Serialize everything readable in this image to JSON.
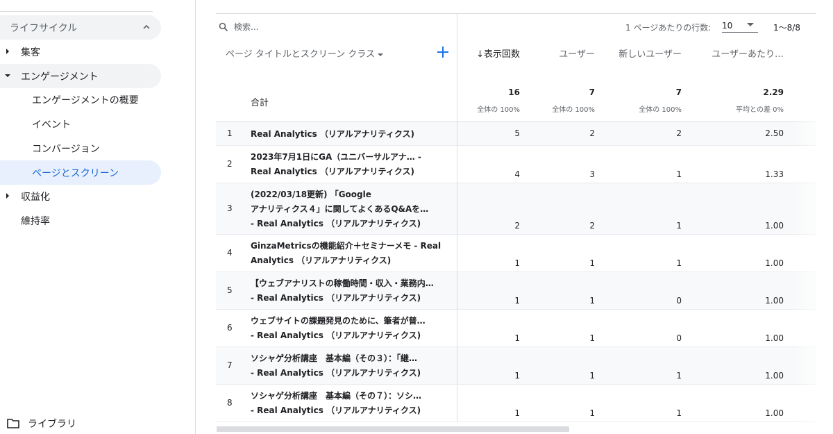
{
  "sidebar": {
    "section_title": "ライフサイクル",
    "items": [
      {
        "label": "集客"
      },
      {
        "label": "エンゲージメント"
      },
      {
        "label": "エンゲージメントの概要"
      },
      {
        "label": "イベント"
      },
      {
        "label": "コンバージョン"
      },
      {
        "label": "ページとスクリーン"
      },
      {
        "label": "収益化"
      },
      {
        "label": "維持率"
      }
    ],
    "library_label": "ライブラリ"
  },
  "toolbar": {
    "search_placeholder": "検索...",
    "rows_per_page_label": "1 ページあたりの行数:",
    "rows_per_page_value": "10",
    "pager_text": "1〜8/8"
  },
  "table": {
    "dimension_header": "ページ タイトルとスクリーン クラス",
    "metric_headers": [
      "↓表示回数",
      "ユーザー",
      "新しいユーザー",
      "ユーザーあたり…"
    ],
    "total_label": "合計",
    "totals": [
      {
        "value": "16",
        "sub": "全体の 100%"
      },
      {
        "value": "7",
        "sub": "全体の 100%"
      },
      {
        "value": "7",
        "sub": "全体の 100%"
      },
      {
        "value": "2.29",
        "sub": "平均との差 0%"
      }
    ],
    "rows": [
      {
        "index": "1",
        "lines": [
          "Real Analytics （リアルアナリティクス)"
        ],
        "values": [
          "5",
          "2",
          "2",
          "2.50"
        ]
      },
      {
        "index": "2",
        "lines": [
          "2023年7月1日にGA（ユニバーサルアナ… -",
          "Real Analytics （リアルアナリティクス)"
        ],
        "values": [
          "4",
          "3",
          "1",
          "1.33"
        ]
      },
      {
        "index": "3",
        "lines": [
          "(2022/03/18更新) 「Google",
          "アナリティクス４」に関してよくあるQ&Aを…",
          "- Real Analytics （リアルアナリティクス)"
        ],
        "values": [
          "2",
          "2",
          "1",
          "1.00"
        ]
      },
      {
        "index": "4",
        "lines": [
          "GinzaMetricsの機能紹介＋セミナーメモ - Real",
          "Analytics （リアルアナリティクス)"
        ],
        "values": [
          "1",
          "1",
          "1",
          "1.00"
        ]
      },
      {
        "index": "5",
        "lines": [
          "【ウェブアナリストの稼働時間・収入・業務内…",
          "- Real Analytics （リアルアナリティクス)"
        ],
        "values": [
          "1",
          "1",
          "0",
          "1.00"
        ]
      },
      {
        "index": "6",
        "lines": [
          "ウェブサイトの課題発見のために、筆者が普…",
          "- Real Analytics （リアルアナリティクス)"
        ],
        "values": [
          "1",
          "1",
          "0",
          "1.00"
        ]
      },
      {
        "index": "7",
        "lines": [
          "ソシャゲ分析講座　基本編（その３）：「継…",
          "- Real Analytics （リアルアナリティクス)"
        ],
        "values": [
          "1",
          "1",
          "1",
          "1.00"
        ]
      },
      {
        "index": "8",
        "lines": [
          "ソシャゲ分析講座　基本編（その７）：ソシ…",
          "- Real Analytics （リアルアナリティクス)"
        ],
        "values": [
          "1",
          "1",
          "1",
          "1.00"
        ]
      }
    ]
  },
  "colors": {
    "accent": "#1a73e8",
    "active_text": "#1967d2",
    "active_bg": "#e8f0fe",
    "hover_bg": "#f1f3f4"
  }
}
